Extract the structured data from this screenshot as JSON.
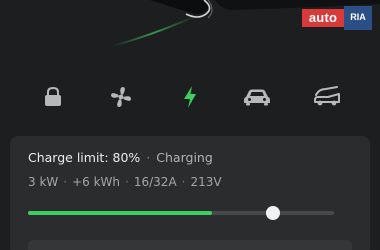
{
  "watermark": {
    "brand_auto": "auto",
    "brand_ria": "RIA"
  },
  "icons": [
    {
      "name": "lock-icon",
      "active": false
    },
    {
      "name": "fan-icon",
      "active": false
    },
    {
      "name": "charging-bolt-icon",
      "active": true
    },
    {
      "name": "car-icon",
      "active": false
    },
    {
      "name": "trunk-open-icon",
      "active": false
    }
  ],
  "charge": {
    "limit_text": "Charge limit: 80%",
    "separator": "·",
    "status_text": "Charging",
    "stats": [
      "3 kW",
      "+6 kWh",
      "16/32A",
      "213V"
    ],
    "slider_fill_fraction": 0.6,
    "slider_limit_fraction": 0.8
  },
  "colors": {
    "background": "#1d1e20",
    "panel": "#2b2c2e",
    "accent_green": "#3ccf5c",
    "icon_gray": "#b8b8b8"
  }
}
